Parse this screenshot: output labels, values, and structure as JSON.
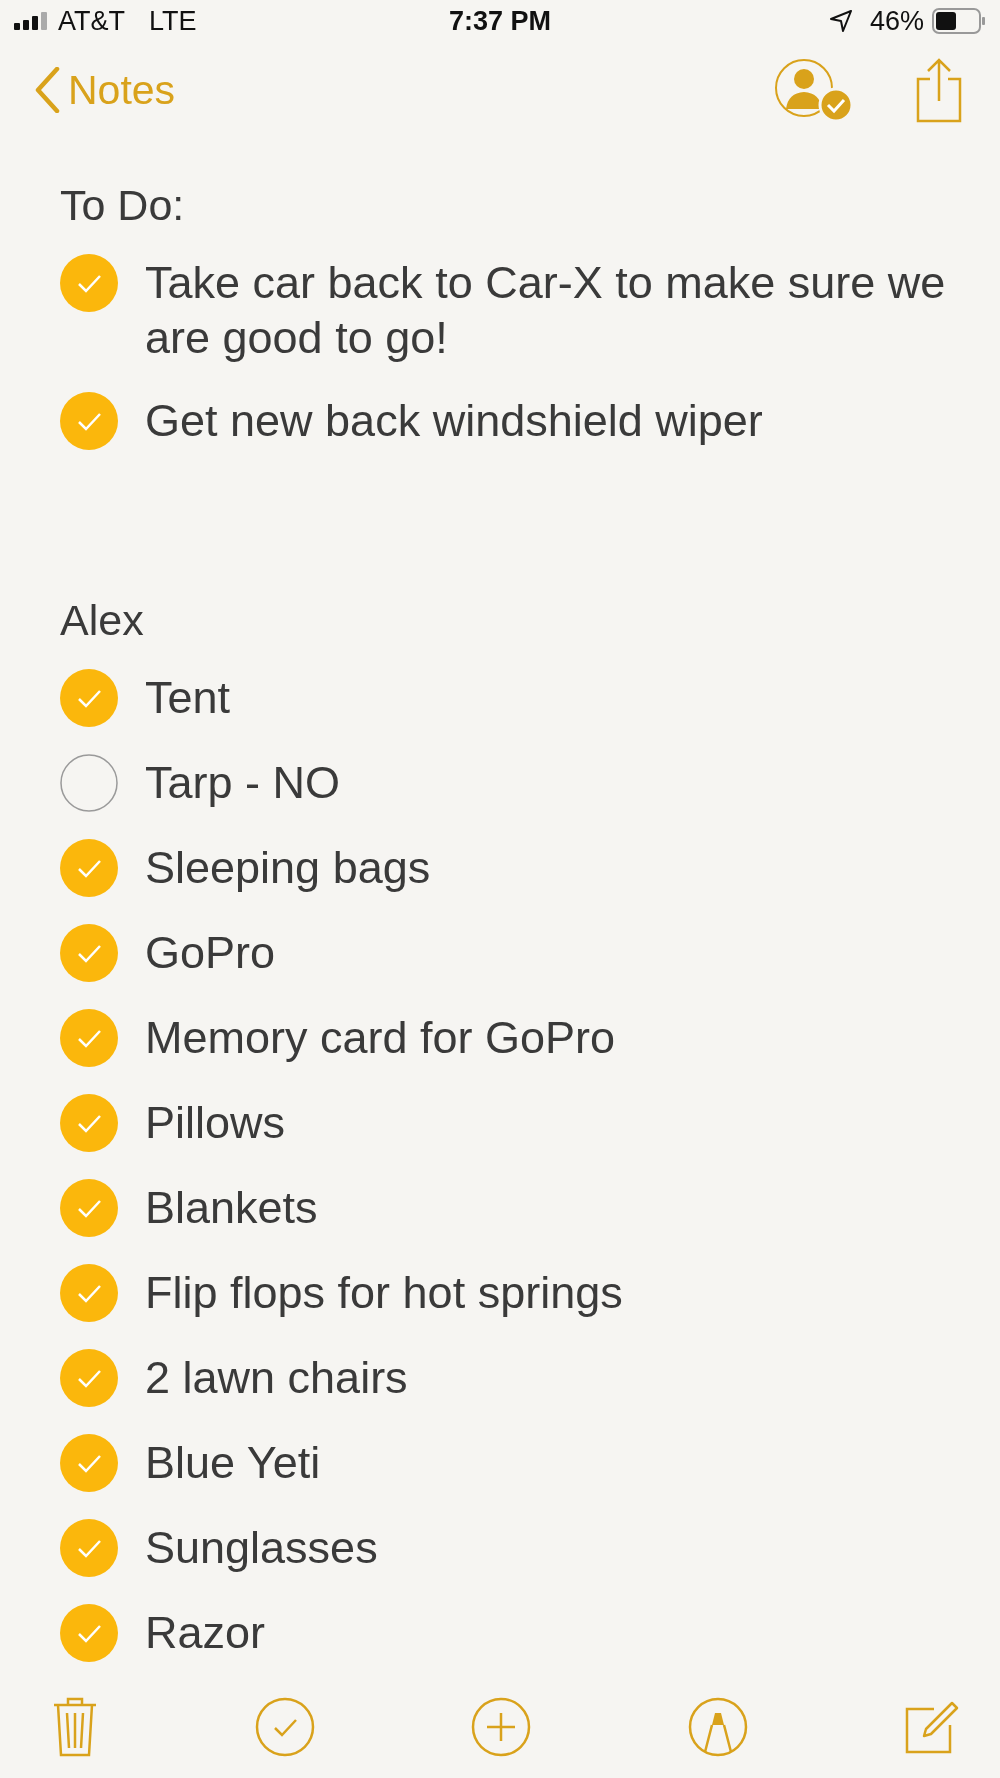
{
  "status_bar": {
    "carrier": "AT&T",
    "network": "LTE",
    "time": "7:37 PM",
    "battery": "46%"
  },
  "nav": {
    "back_label": "Notes"
  },
  "sections": [
    {
      "heading": "To Do:",
      "items": [
        {
          "text": "Take car back to Car-X to make sure we are good to go!",
          "checked": true
        },
        {
          "text": "Get new back windshield wiper",
          "checked": true
        }
      ]
    },
    {
      "heading": "Alex",
      "items": [
        {
          "text": "Tent",
          "checked": true
        },
        {
          "text": "Tarp - NO",
          "checked": false
        },
        {
          "text": "Sleeping bags",
          "checked": true
        },
        {
          "text": "GoPro",
          "checked": true
        },
        {
          "text": "Memory card for GoPro",
          "checked": true
        },
        {
          "text": "Pillows",
          "checked": true
        },
        {
          "text": "Blankets",
          "checked": true
        },
        {
          "text": "Flip flops for hot springs",
          "checked": true
        },
        {
          "text": "2 lawn chairs",
          "checked": true
        },
        {
          "text": "Blue Yeti",
          "checked": true
        },
        {
          "text": "Sunglasses",
          "checked": true
        },
        {
          "text": "Razor",
          "checked": true
        }
      ]
    }
  ]
}
